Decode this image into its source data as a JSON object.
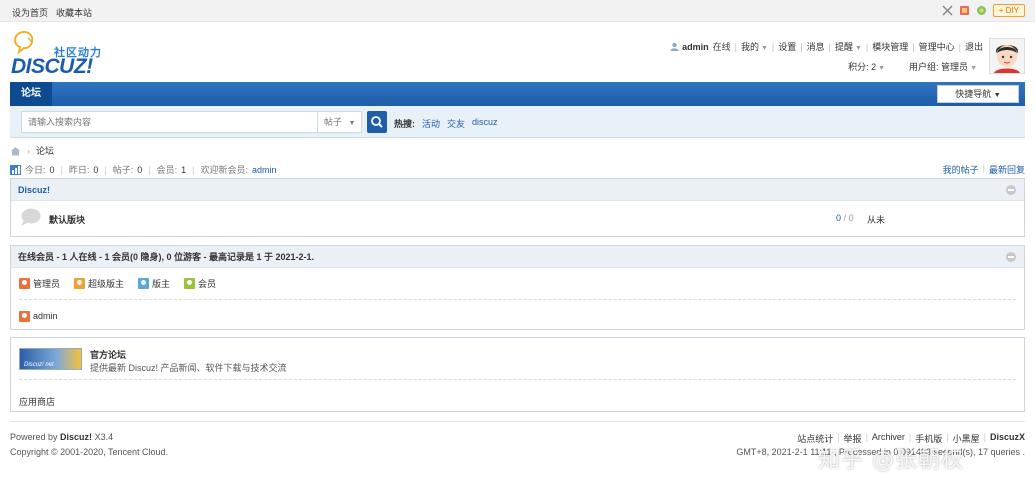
{
  "toolbar": {
    "set_home": "设为首页",
    "bookmark": "收藏本站",
    "diy": "DIY"
  },
  "logo": {
    "tagline": "社区动力",
    "wordmark": "DISCUZ!"
  },
  "user_nav": {
    "username": "admin",
    "status": "在线",
    "mine": "我的",
    "settings": "设置",
    "messages": "消息",
    "reminders": "提醒",
    "module_manage": "模块管理",
    "admin_center": "管理中心",
    "logout": "退出",
    "points": "积分: 2",
    "usergroup": "用户组: 管理员"
  },
  "navbar": {
    "active_tab": "论坛",
    "quick_nav": "快捷导航"
  },
  "search": {
    "placeholder": "请输入搜索内容",
    "type": "帖子",
    "hot_label": "热搜:",
    "hot_terms": [
      "活动",
      "交友",
      "discuz"
    ]
  },
  "breadcrumb": {
    "current": "论坛",
    "separator": "›"
  },
  "stats": {
    "today_label": "今日:",
    "today": "0",
    "yesterday_label": "昨日:",
    "yesterday": "0",
    "posts_label": "帖子:",
    "posts": "0",
    "members_label": "会员:",
    "members": "1",
    "welcome_label": "欢迎新会员:",
    "new_member": "admin",
    "my_posts": "我的帖子",
    "latest_replies": "最新回复"
  },
  "forum_category": {
    "title": "Discuz!",
    "forums": [
      {
        "name": "默认版块",
        "threads": "0",
        "sep": "/",
        "posts": "0",
        "last_post": "从未"
      }
    ]
  },
  "online": {
    "title": "在线会员 - 1 人在线 - 1 会员(0 隐身), 0 位游客 - 最高记录是 1 于 2021-2-1.",
    "legend": [
      {
        "label": "管理员",
        "color": "#e8743a"
      },
      {
        "label": "超级版主",
        "color": "#f0a030"
      },
      {
        "label": "版主",
        "color": "#5aa6e0"
      },
      {
        "label": "会员",
        "color": "#9cc13a"
      }
    ],
    "users": [
      {
        "name": "admin",
        "color": "#e8743a"
      }
    ]
  },
  "links": {
    "banner_text": "Discuz! net",
    "title": "官方论坛",
    "description": "提供最新 Discuz! 产品新闻、软件下载与技术交流",
    "app_store": "应用商店"
  },
  "footer": {
    "powered_prefix": "Powered by",
    "powered_name": "Discuz!",
    "powered_version": "X3.4",
    "copyright": "Copyright © 2001-2020, Tencent Cloud.",
    "links": [
      "站点统计",
      "举报",
      "Archiver",
      "手机版",
      "小黑屋"
    ],
    "brand": "DiscuzX",
    "gmt": "GMT+8, 2021-2-1 11:11 , Processed in 0.091493 second(s), 17 queries .",
    "watermark": "知乎 @张朝权"
  }
}
